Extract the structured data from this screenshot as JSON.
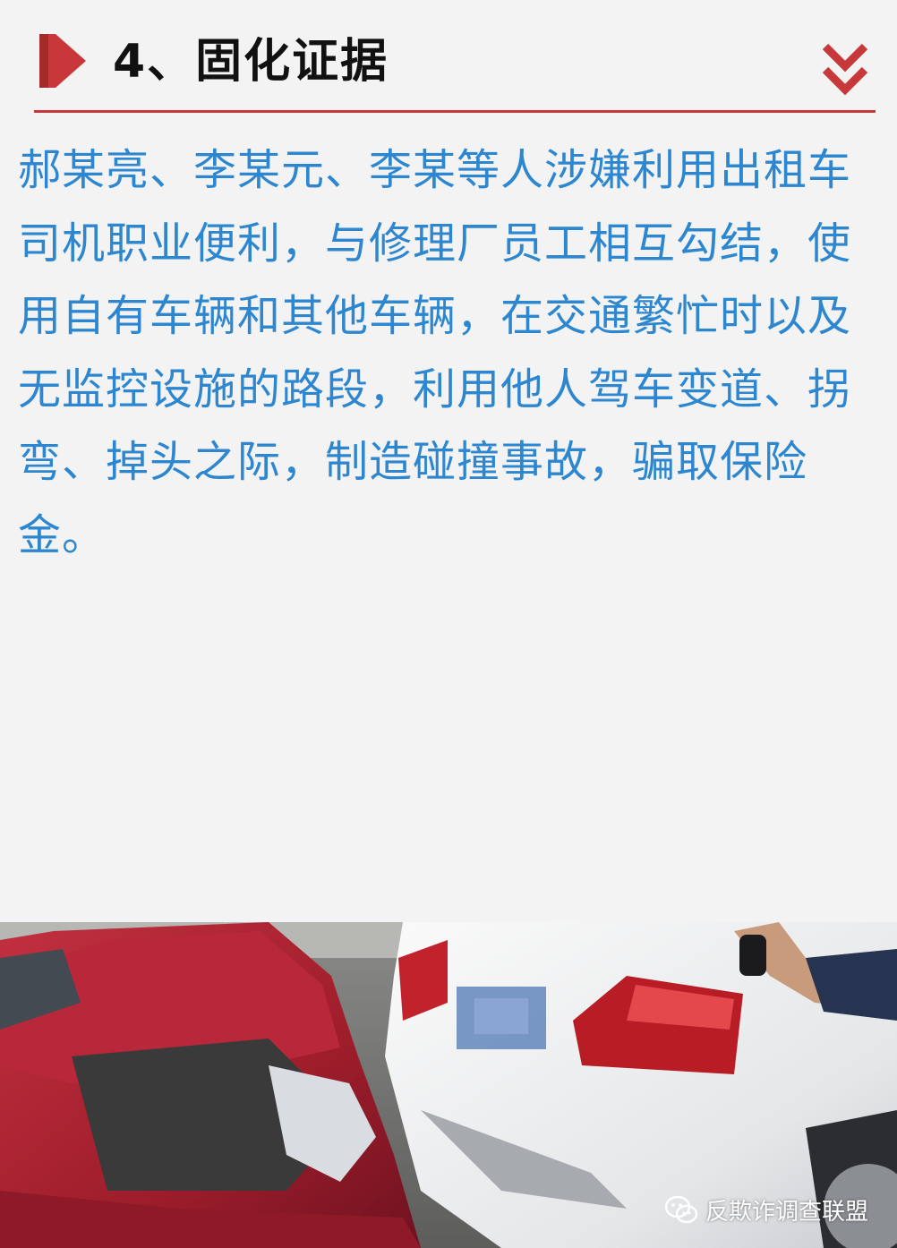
{
  "header": {
    "title": "4、固化证据"
  },
  "content": {
    "paragraph": "郝某亮、李某元、李某等人涉嫌利用出租车司机职业便利，与修理厂员工相互勾结，使用自有车辆和其他车辆，在交通繁忙时以及无监控设施的路段，利用他人驾车变道、拐弯、掉头之际，制造碰撞事故，骗取保险金。"
  },
  "photo": {
    "watermark": "反欺诈调查联盟"
  },
  "colors": {
    "accent_red": "#c8383a",
    "text_blue": "#2c86d0",
    "background": "#f3f3f3"
  },
  "icons": {
    "header_left": "red-arrow-icon",
    "header_right": "double-chevron-down-icon",
    "watermark": "wechat-icon"
  }
}
